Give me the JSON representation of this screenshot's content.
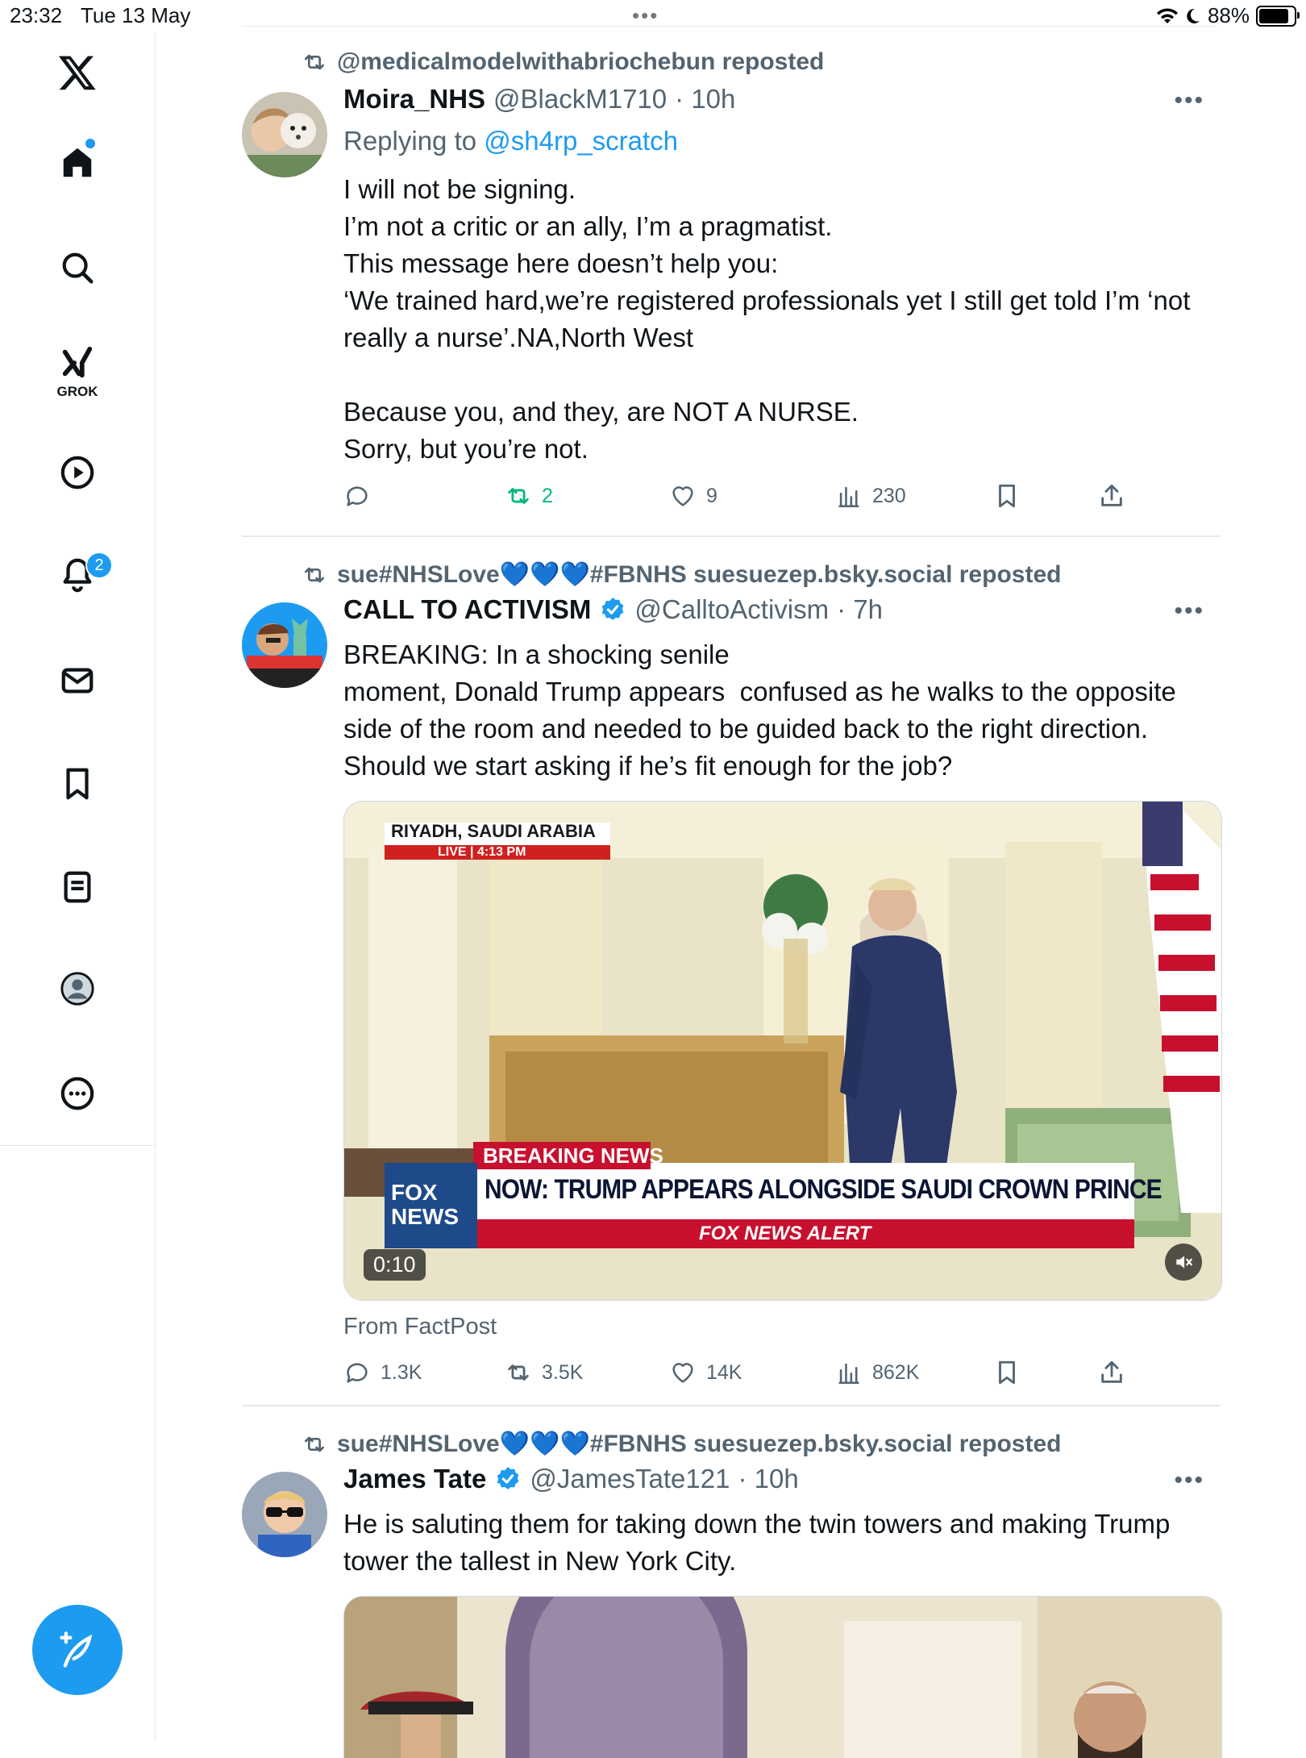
{
  "status_bar": {
    "time": "23:32",
    "date": "Tue 13 May",
    "battery": "88%",
    "dots": "•••"
  },
  "sidebar": {
    "logo": "x-logo-icon",
    "grok_label": "GROK",
    "notifications_badge": "2",
    "items": [
      "home-icon",
      "search-icon",
      "grok-icon",
      "video-icon",
      "notifications-icon",
      "messages-icon",
      "bookmarks-icon",
      "lists-icon",
      "profile-icon",
      "more-icon"
    ]
  },
  "tweets": [
    {
      "reposted_by": "@medicalmodelwithabriochebun reposted",
      "name": "Moira_NHS",
      "handle": "@BlackM1710",
      "time": "· 10h",
      "replying_prefix": "Replying to ",
      "replying_to": "@sh4rp_scratch",
      "text": "I will not be signing.\nI’m not a critic or an ally, I’m a pragmatist.\nThis message here doesn’t help you:\n‘We trained hard,we’re registered professionals yet I still get told I’m ‘not really a nurse’.NA,North West\n\nBecause you, and they, are NOT A NURSE.\nSorry, but you’re not.",
      "replies": "",
      "reposts": "2",
      "likes": "9",
      "views": "230"
    },
    {
      "reposted_by": "sue#NHSLove💙💙💙#FBNHS suesuezep.bsky.social reposted",
      "name": "CALL TO ACTIVISM",
      "handle": "@CalltoActivism",
      "time": "· 7h",
      "text": "BREAKING: In a shocking senile\nmoment, Donald Trump appears  confused as he walks to the opposite side of the room and needed to be guided back to the right direction. Should we start asking if he’s fit enough for the job?",
      "video": {
        "location": "RIYADH, SAUDI ARABIA",
        "live": "LIVE",
        "live_time": "4:13 PM",
        "breaking": "BREAKING NEWS",
        "headline": "NOW: TRUMP APPEARS ALONGSIDE SAUDI CROWN PRINCE",
        "alert": "FOX NEWS ALERT",
        "channel": "FOX NEWS",
        "duration": "0:10"
      },
      "source": "From FactPost",
      "replies": "1.3K",
      "reposts": "3.5K",
      "likes": "14K",
      "views": "862K"
    },
    {
      "reposted_by": "sue#NHSLove💙💙💙#FBNHS suesuezep.bsky.social reposted",
      "name": "James Tate",
      "handle": "@JamesTate121",
      "time": "· 10h",
      "text": "He is saluting them for taking down the twin towers and making Trump tower the tallest in New York City."
    }
  ],
  "colors": {
    "accent": "#1d9bf0",
    "muted": "#536471",
    "repost_green": "#00ba7c",
    "divider": "#e6e8ea"
  }
}
